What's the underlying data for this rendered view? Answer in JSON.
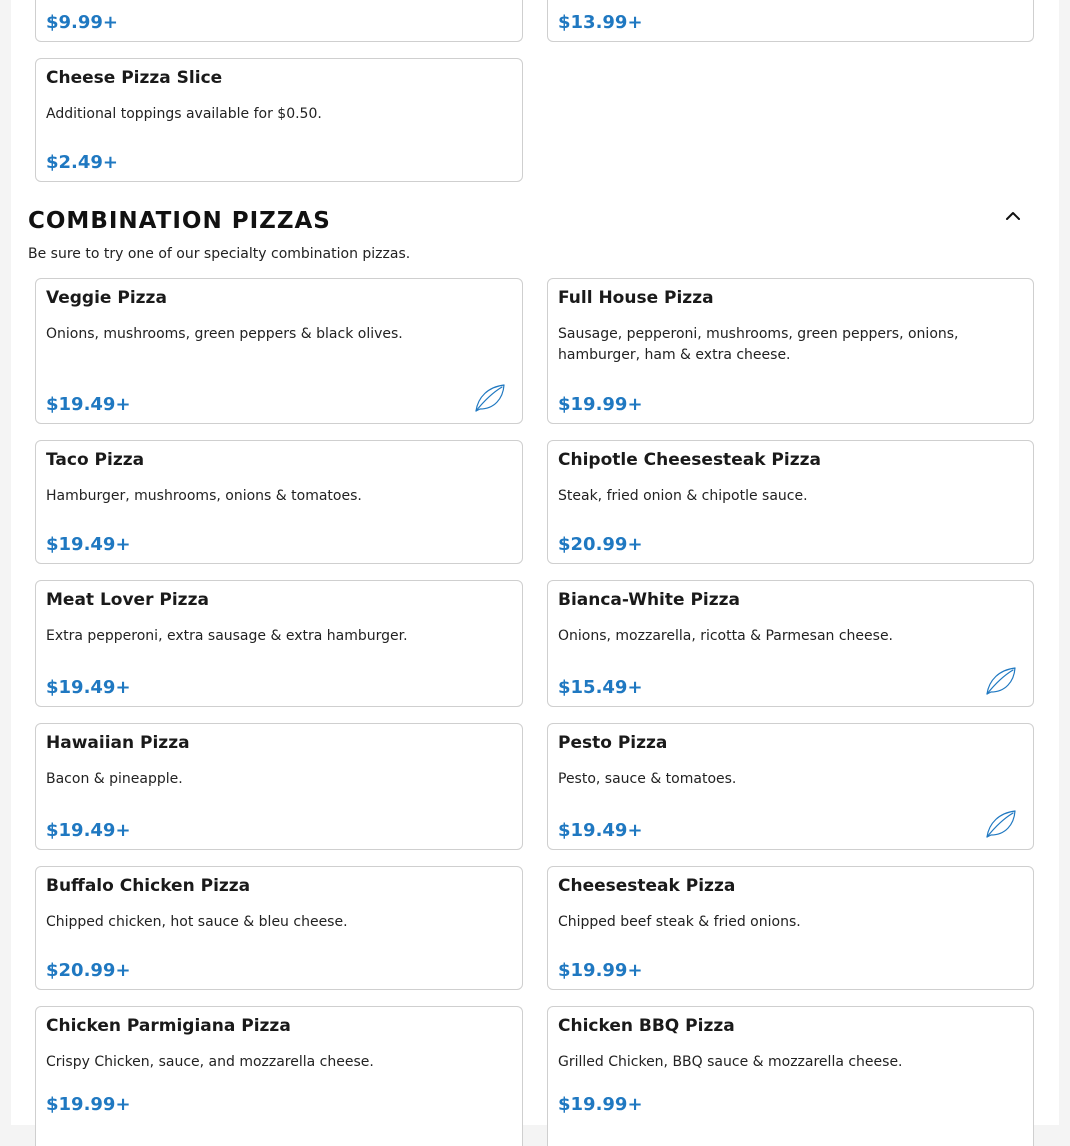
{
  "top_items": [
    {
      "price": "$9.99+"
    },
    {
      "price": "$13.99+"
    }
  ],
  "cheese_slice": {
    "name": "Cheese Pizza Slice",
    "description": "Additional toppings available for $0.50.",
    "price": "$2.49+"
  },
  "section": {
    "title": "COMBINATION PIZZAS",
    "subtitle": "Be sure to try one of our specialty combination pizzas.",
    "collapse_icon": "chevron-up-icon"
  },
  "items": [
    {
      "name": "Veggie Pizza",
      "description": "Onions, mushrooms, green peppers & black olives.",
      "price": "$19.49+",
      "vegetarian": true
    },
    {
      "name": "Full House Pizza",
      "description": "Sausage, pepperoni, mushrooms, green peppers, onions, hamburger, ham & extra cheese.",
      "price": "$19.99+",
      "vegetarian": false
    },
    {
      "name": "Taco Pizza",
      "description": "Hamburger, mushrooms, onions & tomatoes.",
      "price": "$19.49+",
      "vegetarian": false
    },
    {
      "name": "Chipotle Cheesesteak Pizza",
      "description": "Steak, fried onion & chipotle sauce.",
      "price": "$20.99+",
      "vegetarian": false
    },
    {
      "name": "Meat Lover Pizza",
      "description": "Extra pepperoni, extra sausage & extra hamburger.",
      "price": "$19.49+",
      "vegetarian": false
    },
    {
      "name": "Bianca-White Pizza",
      "description": "Onions, mozzarella, ricotta & Parmesan cheese.",
      "price": "$15.49+",
      "vegetarian": true
    },
    {
      "name": "Hawaiian Pizza",
      "description": "Bacon & pineapple.",
      "price": "$19.49+",
      "vegetarian": false
    },
    {
      "name": "Pesto Pizza",
      "description": "Pesto, sauce & tomatoes.",
      "price": "$19.49+",
      "vegetarian": true
    },
    {
      "name": "Buffalo Chicken Pizza",
      "description": "Chipped chicken, hot sauce & bleu cheese.",
      "price": "$20.99+",
      "vegetarian": false
    },
    {
      "name": "Cheesesteak Pizza",
      "description": "Chipped beef steak & fried onions.",
      "price": "$19.99+",
      "vegetarian": false
    },
    {
      "name": "Chicken Parmigiana Pizza",
      "description": "Crispy Chicken, sauce, and mozzarella cheese.",
      "price": "$19.99+",
      "vegetarian": false
    },
    {
      "name": "Chicken BBQ Pizza",
      "description": "Grilled Chicken, BBQ sauce & mozzarella cheese.",
      "price": "$19.99+",
      "vegetarian": false
    }
  ],
  "colors": {
    "price": "#1f78c1",
    "vegetarian_icon": "#1f78c1",
    "card_border": "#cfcfcf"
  },
  "icons": {
    "vegetarian": "leaf-icon"
  }
}
